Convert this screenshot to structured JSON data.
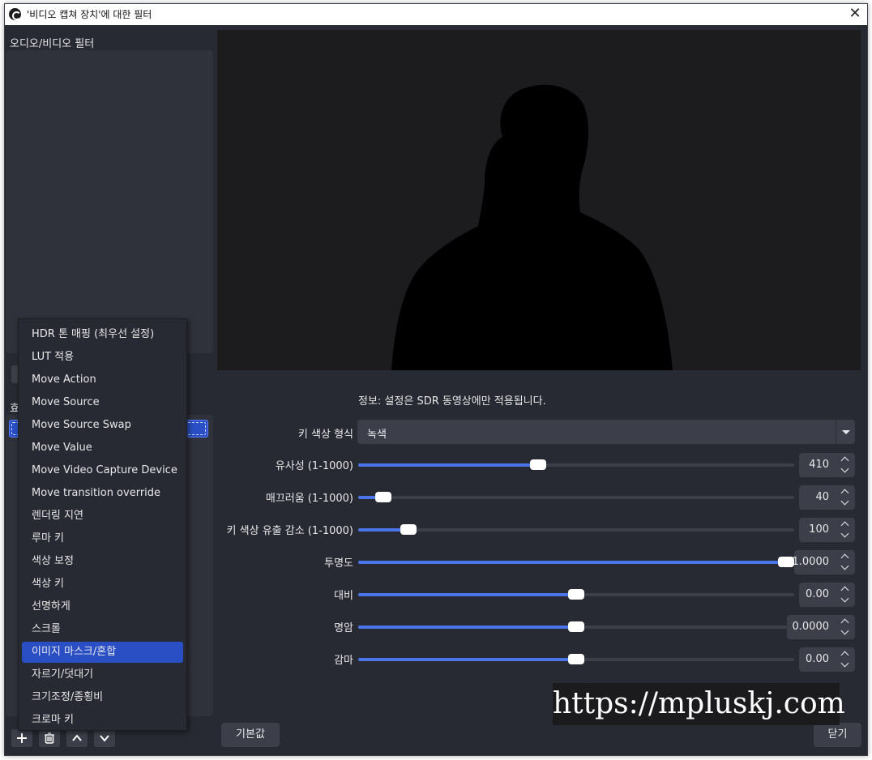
{
  "window": {
    "title": "'비디오 캡쳐 장치'에 대한 필터",
    "close_label": "✕"
  },
  "left": {
    "audio_video_label": "오디오/비디오 필터",
    "effect_label": "효과 필터",
    "add_label": "+"
  },
  "menu": {
    "items": [
      "HDR 톤 매핑 (최우선 설정)",
      "LUT 적용",
      "Move Action",
      "Move Source",
      "Move Source Swap",
      "Move Value",
      "Move Video Capture Device",
      "Move transition override",
      "렌더링 지연",
      "루마 키",
      "색상 보정",
      "색상 키",
      "선명하게",
      "스크롤",
      "이미지 마스크/혼합",
      "자르기/덧대기",
      "크기조정/종횡비",
      "크로마 키"
    ],
    "active_index": 14
  },
  "settings": {
    "info": "정보: 설정은 SDR 동영상에만 적용됩니다.",
    "key_color_type": {
      "label": "키 색상 형식",
      "value": "녹색"
    },
    "sliders": [
      {
        "label": "유사성 (1-1000)",
        "value": "410",
        "fraction": 0.41
      },
      {
        "label": "매끄러움 (1-1000)",
        "value": "40",
        "fraction": 0.04
      },
      {
        "label": "키 색상 유출 감소 (1-1000)",
        "value": "100",
        "fraction": 0.1
      },
      {
        "label": "투명도",
        "value": "1.0000",
        "fraction": 1.0
      },
      {
        "label": "대비",
        "value": "0.00",
        "fraction": 0.5
      },
      {
        "label": "명암",
        "value": "0.0000",
        "fraction": 0.5
      },
      {
        "label": "감마",
        "value": "0.00",
        "fraction": 0.5
      }
    ]
  },
  "buttons": {
    "defaults": "기본값",
    "close": "닫기"
  },
  "watermark": "https://mpluskj.com"
}
